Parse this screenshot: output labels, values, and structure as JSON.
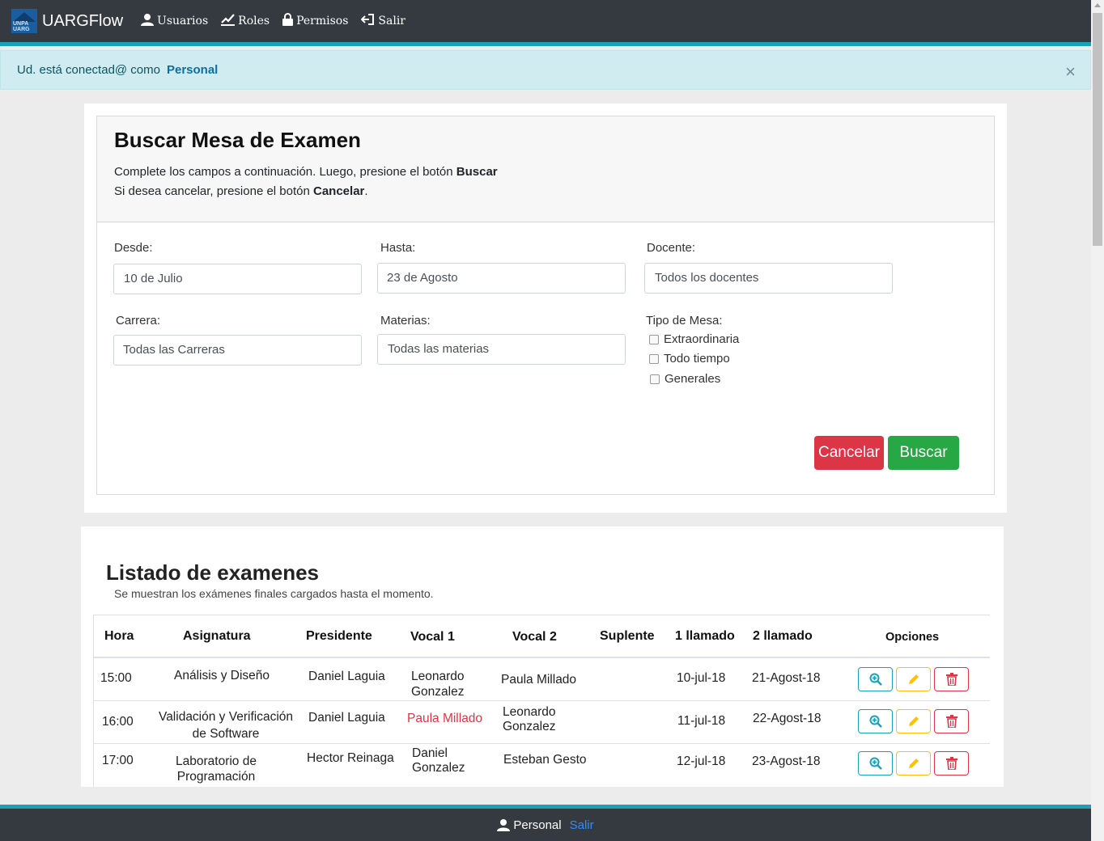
{
  "navbar": {
    "logo_text": "UNPA UARG",
    "brand": "UARGFlow",
    "items": [
      {
        "label": "Usuarios",
        "icon": "user-icon"
      },
      {
        "label": "Roles",
        "icon": "chart-line-icon"
      },
      {
        "label": "Permisos",
        "icon": "lock-icon"
      },
      {
        "label": "Salir",
        "icon": "sign-out-icon"
      }
    ]
  },
  "alert": {
    "text": "Ud. está conectad@ como",
    "user": "Personal",
    "close": "×"
  },
  "search": {
    "title": "Buscar Mesa de Examen",
    "line1_text": "Complete los campos a continuación. Luego, presione el botón ",
    "line1_bold": "Buscar",
    "line2_text": "Si desea cancelar, presione el botón ",
    "line2_bold": "Cancelar",
    "line2_end": ".",
    "desde_label": "Desde:",
    "desde_value": "10 de Julio",
    "hasta_label": "Hasta:",
    "hasta_value": "23 de Agosto",
    "docente_label": "Docente:",
    "docente_value": "Todos los docentes",
    "carrera_label": "Carrera:",
    "carrera_value": "Todas las Carreras",
    "materias_label": "Materias:",
    "materias_value": "Todas las materias",
    "tipo_label": "Tipo de Mesa:",
    "tipos": [
      "Extraordinaria",
      "Todo tiempo",
      "Generales"
    ],
    "cancel_button": "Cancelar",
    "search_button": "Buscar"
  },
  "list": {
    "title": "Listado de examenes",
    "subtitle": "Se muestran los exámenes finales cargados hasta el momento.",
    "headers": [
      "Hora",
      "Asignatura",
      "Presidente",
      "Vocal 1",
      "Vocal 2",
      "Suplente",
      "1 llamado",
      "2 llamado",
      "Opciones"
    ],
    "rows": [
      {
        "hora": "15:00",
        "asignatura_1": "Análisis y Diseño",
        "asignatura_2": "",
        "presidente": "Daniel Laguia",
        "vocal1_1": "Leonardo",
        "vocal1_2": "Gonzalez",
        "vocal2_1": "Paula Millado",
        "vocal2_2": "",
        "suplente": "",
        "llamado1": "10-jul-18",
        "llamado2": "21-Agost-18"
      },
      {
        "hora": "16:00",
        "asignatura_1": "Validación y Verificación",
        "asignatura_2": "de Software",
        "presidente": "Daniel Laguia",
        "vocal1_1": "Paula Millado",
        "vocal1_2": "",
        "vocal2_1": "Leonardo",
        "vocal2_2": "Gonzalez",
        "suplente": "",
        "llamado1": "11-jul-18",
        "llamado2": "22-Agost-18"
      },
      {
        "hora": "17:00",
        "asignatura_1": "Laboratorio de",
        "asignatura_2": "Programación",
        "presidente": "Hector Reinaga",
        "vocal1_1": "Daniel",
        "vocal1_2": "Gonzalez",
        "vocal2_1": "Esteban Gesto",
        "vocal2_2": "",
        "suplente": "",
        "llamado1": "12-jul-18",
        "llamado2": "23-Agost-18"
      }
    ]
  },
  "footer": {
    "user": "Personal",
    "logout": "Salir"
  },
  "colors": {
    "navbar": "#343a40",
    "accent": "#17a2b8",
    "danger": "#dc3545",
    "success": "#28a745",
    "warning": "#ffc107"
  }
}
